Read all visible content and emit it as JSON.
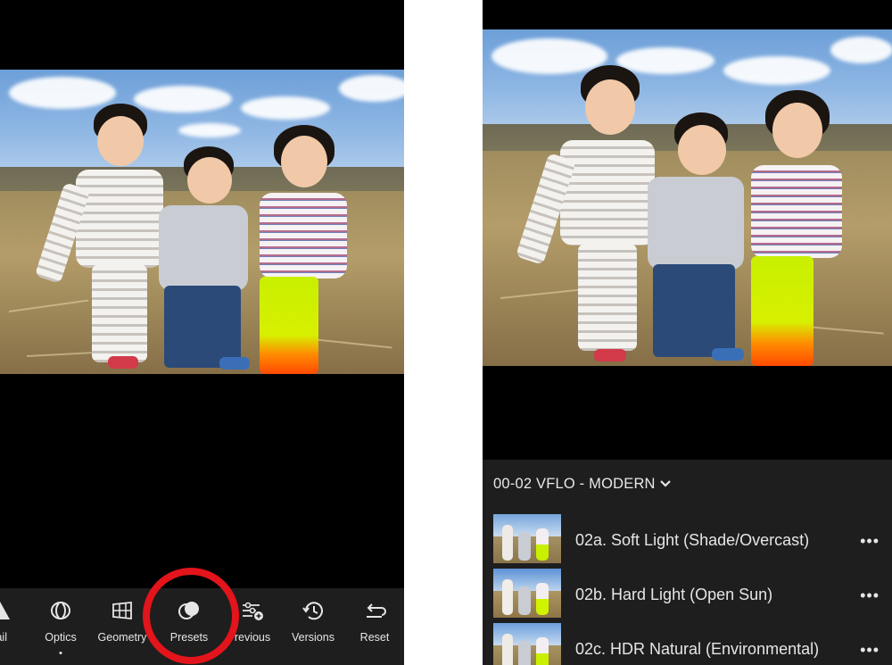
{
  "left_screen": {
    "toolbar": {
      "items": [
        {
          "label": "tail",
          "icon": "detail-triangle-icon"
        },
        {
          "label": "Optics",
          "icon": "optics-lens-icon"
        },
        {
          "label": "Geometry",
          "icon": "geometry-grid-icon"
        },
        {
          "label": "Presets",
          "icon": "presets-overlap-icon"
        },
        {
          "label": "revious",
          "icon": "previous-sliders-icon"
        },
        {
          "label": "Versions",
          "icon": "versions-history-icon"
        },
        {
          "label": "Reset",
          "icon": "reset-undo-icon"
        }
      ],
      "highlighted": "Presets",
      "highlight_color": "#e3141b"
    }
  },
  "right_screen": {
    "preset_group": "00-02 VFLO - MODERN",
    "presets": [
      {
        "label": "02a. Soft Light (Shade/Overcast)",
        "more": "•••"
      },
      {
        "label": "02b. Hard Light (Open Sun)",
        "more": "•••"
      },
      {
        "label": "02c. HDR Natural (Environmental)",
        "more": "•••"
      }
    ]
  }
}
